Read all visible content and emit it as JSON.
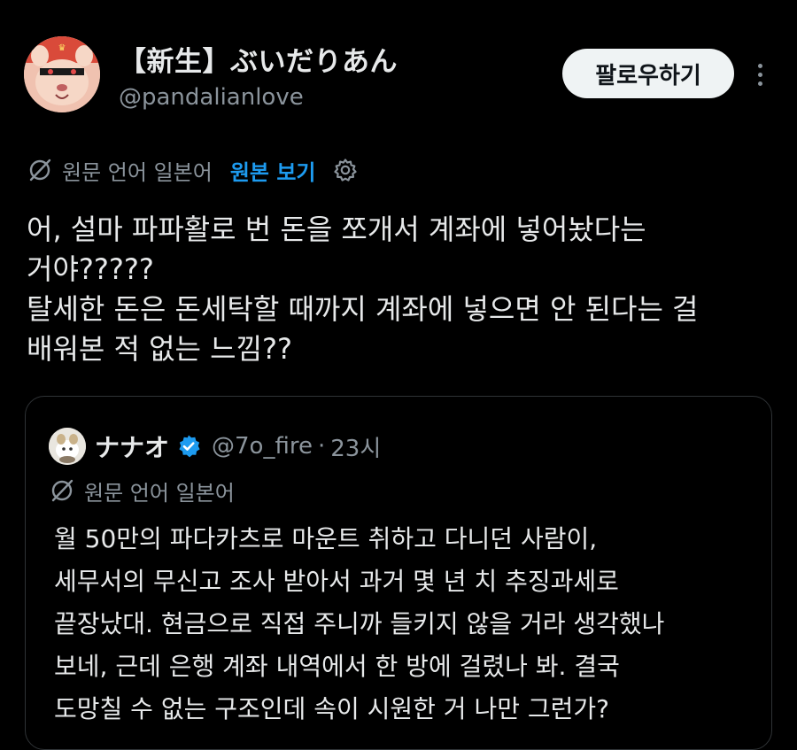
{
  "author": {
    "display_name": "【新生】ぶいだりあん",
    "handle": "@pandalianlove"
  },
  "follow_button_label": "팔로우하기",
  "translation": {
    "source_language": "원문 언어 일본어",
    "show_original_label": "원본 보기"
  },
  "tweet": {
    "lines": [
      "어, 설마 파파활로 번 돈을 쪼개서 계좌에 넣어놨다는",
      "거야?????",
      "탈세한 돈은 돈세탁할 때까지 계좌에 넣으면 안 된다는 걸",
      "배워본 적 없는 느낌??"
    ]
  },
  "quote": {
    "display_name": "ナナオ",
    "handle": "@7o_fire",
    "separator": "·",
    "time": "23시",
    "source_language": "원문 언어 일본어",
    "lines": [
      "월 50만의 파다카츠로 마운트 취하고 다니던 사람이,",
      "세무서의 무신고 조사 받아서 과거 몇 년 치 추징과세로",
      "끝장났대. 현금으로 직접 주니까 들키지 않을 거라 생각했나",
      "보네, 근데 은행 계좌 내역에서 한 방에 걸렸나 봐. 결국",
      "도망칠 수 없는 구조인데 속이 시원한 거 나만 그런가?"
    ]
  },
  "colors": {
    "background": "#000000",
    "primary_text": "#e7e9ea",
    "secondary_text": "#8b949c",
    "accent": "#1d9bf0",
    "follow_button_bg": "#eff3f4",
    "border": "#2f3336"
  },
  "icons": {
    "translate": "translate-globe-icon",
    "settings": "gear-icon",
    "verified": "verified-badge-icon",
    "more": "more-dots-icon"
  }
}
